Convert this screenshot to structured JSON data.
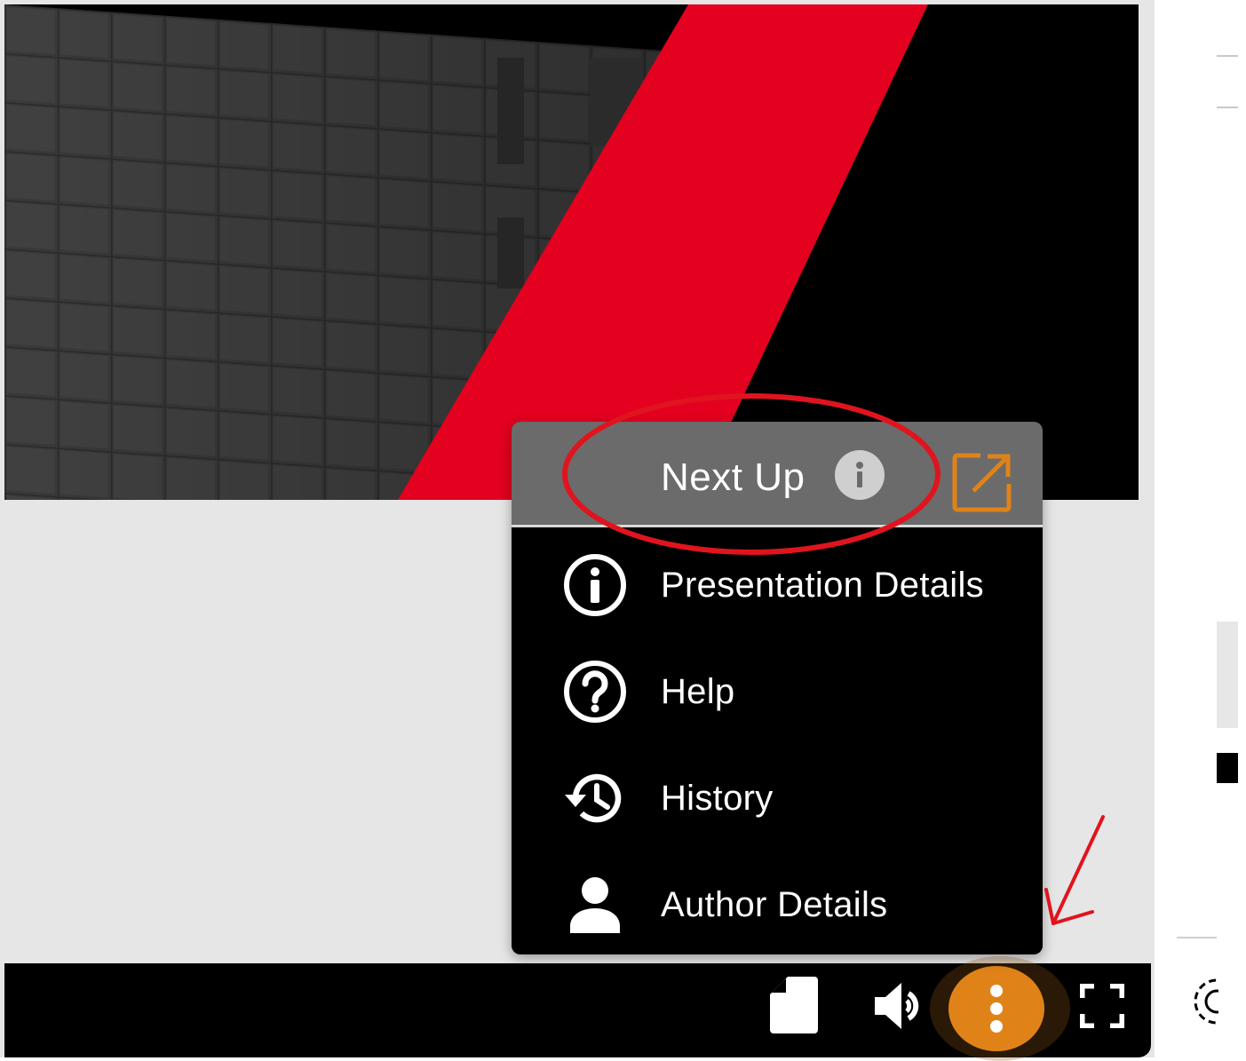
{
  "menu": {
    "header": {
      "title": "Next Up",
      "info_icon": "info-icon",
      "popout_icon": "external-link-icon"
    },
    "items": [
      {
        "label": "Presentation Details",
        "icon": "info-circle-icon"
      },
      {
        "label": "Help",
        "icon": "question-circle-icon"
      },
      {
        "label": "History",
        "icon": "history-icon"
      },
      {
        "label": "Author Details",
        "icon": "person-icon"
      }
    ]
  },
  "controls": {
    "notes": "notes-icon",
    "volume": "volume-icon",
    "more": "more-vertical-icon",
    "fullscreen": "fullscreen-icon",
    "settings": "gear-icon"
  },
  "colors": {
    "accent": "#df8319",
    "slide_red": "#e4001f",
    "menu_header": "#6b6b6b",
    "menu_bg": "#000000",
    "annotation": "#e0141e"
  }
}
